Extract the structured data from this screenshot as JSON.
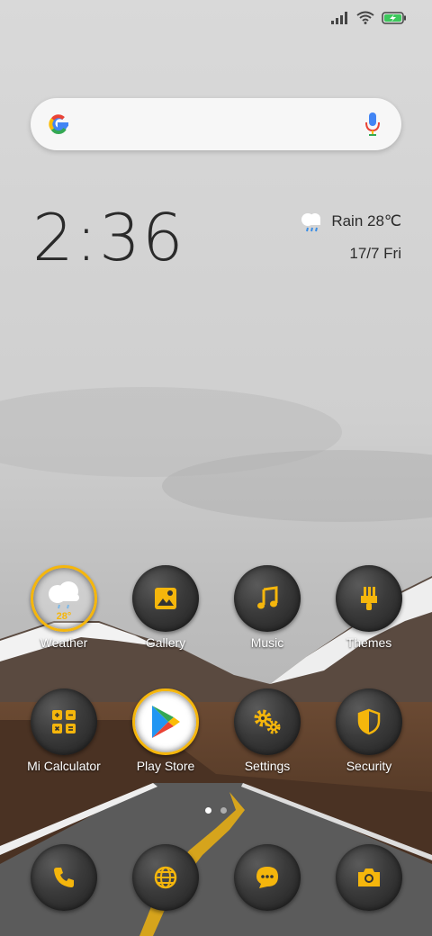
{
  "clock": {
    "time": "2:36"
  },
  "weather_widget": {
    "condition_temp": "Rain 28℃",
    "date": "17/7 Fri"
  },
  "search": {
    "logo": "google-g-icon",
    "mic": "microphone-icon"
  },
  "status_bar": {
    "icons": [
      "signal-icon",
      "wifi-icon",
      "battery-charging-icon"
    ]
  },
  "apps": {
    "row1": [
      {
        "label": "Weather",
        "icon": "weather-icon",
        "temp": "28°"
      },
      {
        "label": "Gallery",
        "icon": "gallery-icon"
      },
      {
        "label": "Music",
        "icon": "music-note-icon"
      },
      {
        "label": "Themes",
        "icon": "brush-icon"
      }
    ],
    "row2": [
      {
        "label": "Mi Calculator",
        "icon": "calculator-icon"
      },
      {
        "label": "Play Store",
        "icon": "play-store-icon"
      },
      {
        "label": "Settings",
        "icon": "gears-icon"
      },
      {
        "label": "Security",
        "icon": "shield-icon"
      }
    ]
  },
  "dock": [
    {
      "icon": "phone-icon"
    },
    {
      "icon": "globe-icon"
    },
    {
      "icon": "message-icon"
    },
    {
      "icon": "camera-icon"
    }
  ],
  "pager": {
    "pages": 2,
    "active": 1
  },
  "colors": {
    "accent": "#f5b60c",
    "icon_bg": "#333333"
  }
}
